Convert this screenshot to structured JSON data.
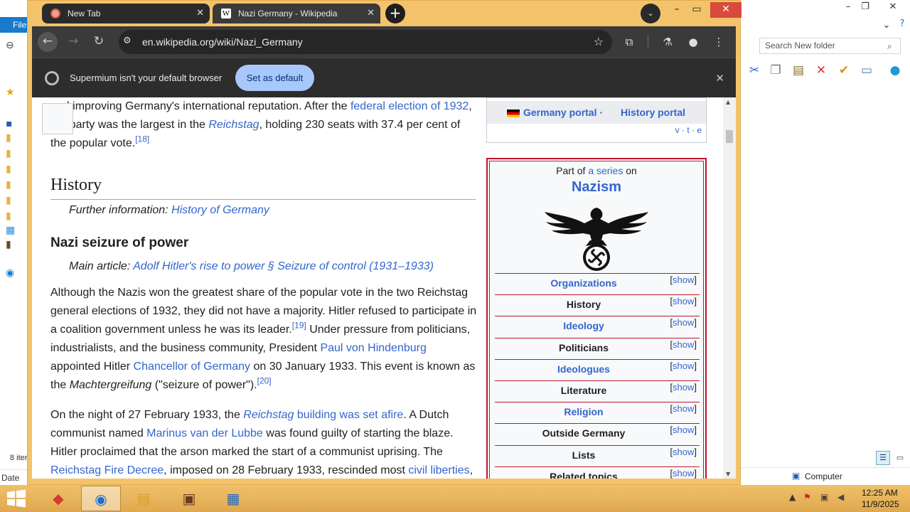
{
  "explorer": {
    "file_menu": "File",
    "search_placeholder": "Search New folder",
    "items_count": "8 iter",
    "date_col": "Date cr",
    "computer": "Computer",
    "min": "–",
    "max": "❐",
    "close": "✕",
    "chevron": "⌄",
    "help": "?"
  },
  "browser": {
    "tabs": [
      {
        "label": "New Tab",
        "active": false
      },
      {
        "label": "Nazi Germany - Wikipedia",
        "active": true
      }
    ],
    "url": "en.wikipedia.org/wiki/Nazi_Germany",
    "infobar_text": "Supermium isn't your default browser",
    "set_default_label": "Set as default"
  },
  "article": {
    "p0": {
      "t1": "and improving Germany's international reputation. After the ",
      "l1": "federal election of 1932",
      "t2": ",",
      "t3": "the party was the largest in the ",
      "l2": "Reichstag",
      "t4": ", holding 230 seats with 37.4 per cent of",
      "t5": "the popular vote.",
      "ref": "[18]"
    },
    "history_heading": "History",
    "history_hatnote_prefix": "Further information: ",
    "history_hatnote_link": "History of Germany",
    "seizure_heading": "Nazi seizure of power",
    "seizure_hatnote_prefix": "Main article: ",
    "seizure_hatnote_link": "Adolf Hitler's rise to power § Seizure of control (1931–1933)",
    "p1": {
      "l1": "Although the Nazis won the greatest share of the popular vote in the two Reichstag",
      "l2": "general elections of 1932, they did not have a majority. Hitler refused to participate in",
      "l3": "a coalition government unless he was its leader.",
      "ref1": "[19]",
      "l3b": " Under pressure from politicians,",
      "l4": "industrialists, and the business community, President ",
      "link1": "Paul von Hindenburg",
      "l5": "appointed Hitler ",
      "link2": "Chancellor of Germany",
      "l5b": " on 30 January 1933. This event is known as",
      "l6a": "the ",
      "l6i": "Machtergreifung",
      "l6b": " (\"seizure of power\").",
      "ref2": "[20]"
    },
    "p2": {
      "l1a": "On the night of 27 February 1933, the ",
      "link1a": "Reichstag",
      "link1b": " building was set afire",
      "l1b": ". A Dutch",
      "l2a": "communist named ",
      "link2": "Marinus van der Lubbe",
      "l2b": " was found guilty of starting the blaze.",
      "l3": "Hitler proclaimed that the arson marked the start of a communist uprising. The",
      "link3": "Reichstag Fire Decree",
      "l4": ", imposed on 28 February 1933, rescinded most ",
      "link4": "civil liberties",
      "l4b": ","
    }
  },
  "navbox": {
    "portal1": "Germany portal",
    "sep": " ·",
    "portal2": "History portal",
    "vte": "v · t · e"
  },
  "sidebar": {
    "part_prefix": "Part of ",
    "part_link": "a series",
    "part_suffix": " on",
    "title": "Nazism",
    "show": "show",
    "rows": [
      {
        "label": "Organizations",
        "link": true
      },
      {
        "label": "History",
        "link": false
      },
      {
        "label": "Ideology",
        "link": true
      },
      {
        "label": "Politicians",
        "link": false
      },
      {
        "label": "Ideologues",
        "link": true
      },
      {
        "label": "Literature",
        "link": false
      },
      {
        "label": "Religion",
        "link": true
      },
      {
        "label": "Outside Germany",
        "link": false
      },
      {
        "label": "Lists",
        "link": false
      },
      {
        "label": "Related topics",
        "link": false
      }
    ]
  },
  "taskbar": {
    "time": "12:25 AM",
    "date": "11/9/2025"
  }
}
